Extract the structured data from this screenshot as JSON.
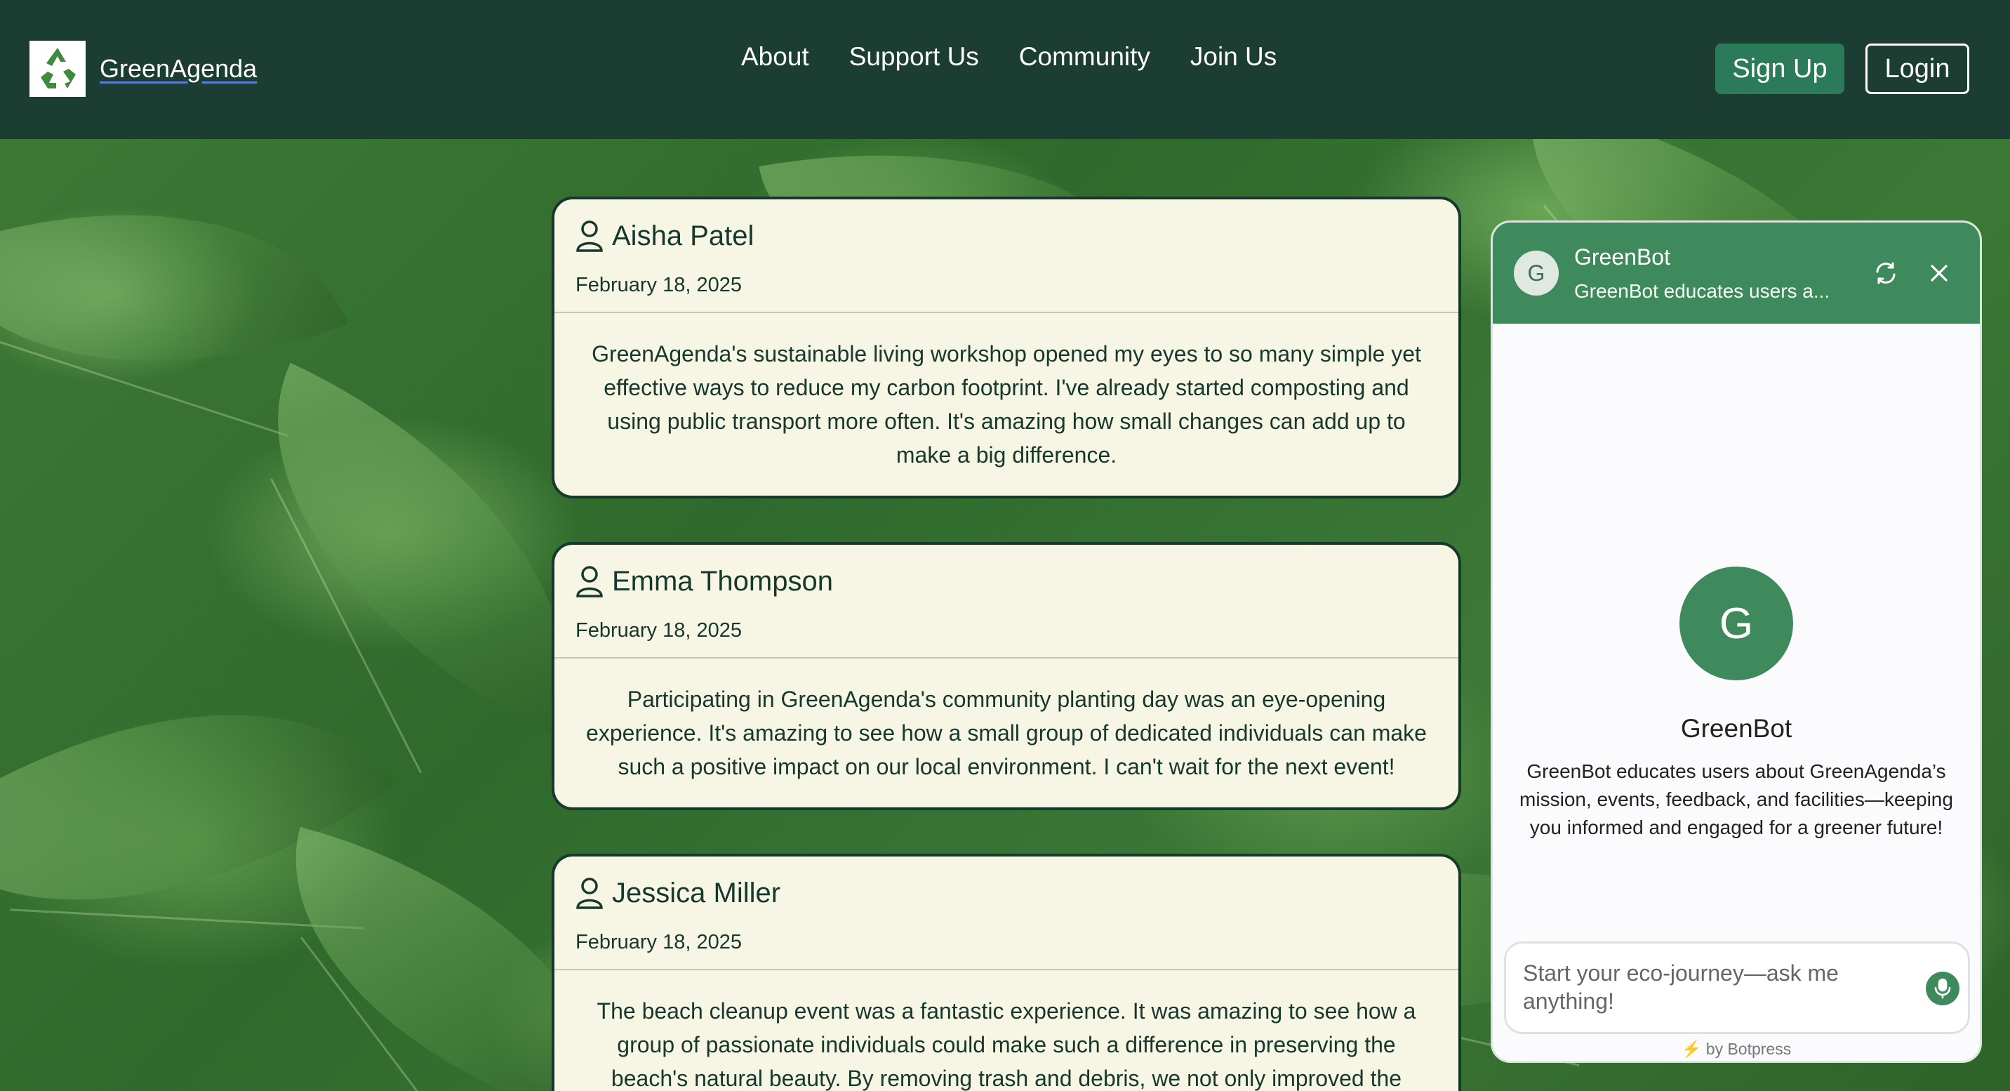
{
  "header": {
    "brand": "GreenAgenda",
    "nav": [
      "About",
      "Support Us",
      "Community",
      "Join Us"
    ],
    "signup_label": "Sign Up",
    "login_label": "Login"
  },
  "testimonials": [
    {
      "name": "Aisha Patel",
      "date": "February 18, 2025",
      "text": "GreenAgenda's sustainable living workshop opened my eyes to so many simple yet effective ways to reduce my carbon footprint. I've already started composting and using public transport more often. It's amazing how small changes can add up to make a big difference."
    },
    {
      "name": "Emma Thompson",
      "date": "February 18, 2025",
      "text": "Participating in GreenAgenda's community planting day was an eye-opening experience. It's amazing to see how a small group of dedicated individuals can make such a positive impact on our local environment. I can't wait for the next event!"
    },
    {
      "name": "Jessica Miller",
      "date": "February 18, 2025",
      "text": "The beach cleanup event was a fantastic experience. It was amazing to see how a group of passionate individuals could make such a difference in preserving the beach's natural beauty. By removing trash and debris, we not only improved the"
    }
  ],
  "chat": {
    "avatar_letter": "G",
    "title": "GreenBot",
    "subtitle": "GreenBot educates users a...",
    "bot_name": "GreenBot",
    "description": "GreenBot educates users about GreenAgenda’s mission, events, feedback, and facilities—keeping you informed and engaged for a greener future!",
    "input_placeholder": "Start your eco-journey—ask me anything!",
    "powered_by": "by Botpress"
  },
  "colors": {
    "header_bg": "#1c3d32",
    "card_bg": "#f7f5e3",
    "accent_green": "#3f8a5c",
    "signup_bg": "#2b7a5a"
  }
}
